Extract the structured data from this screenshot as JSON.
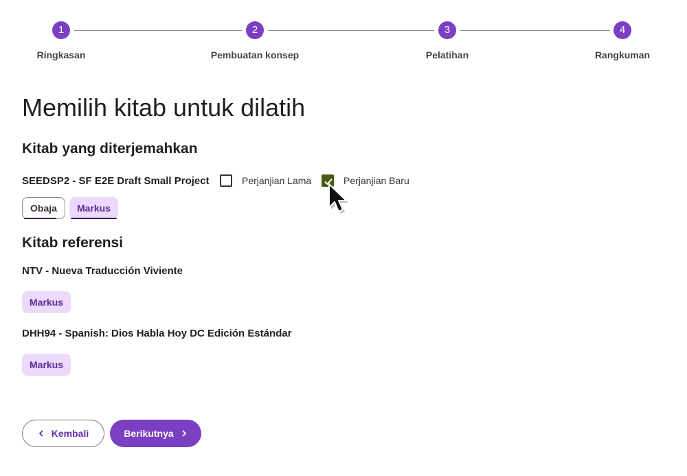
{
  "stepper": {
    "steps": [
      {
        "number": "1",
        "label": "Ringkasan"
      },
      {
        "number": "2",
        "label": "Pembuatan konsep"
      },
      {
        "number": "3",
        "label": "Pelatihan"
      },
      {
        "number": "4",
        "label": "Rangkuman"
      }
    ]
  },
  "page_title": "Memilih kitab untuk dilatih",
  "translated": {
    "section_title": "Kitab yang diterjemahkan",
    "project_name": "SEEDSP2 - SF E2E Draft Small Project",
    "old_testament_label": "Perjanjian Lama",
    "new_testament_label": "Perjanjian Baru",
    "books": [
      "Obaja",
      "Markus"
    ]
  },
  "reference": {
    "section_title": "Kitab referensi",
    "sources": [
      {
        "name": "NTV - Nueva Traducción Viviente",
        "books": [
          "Markus"
        ]
      },
      {
        "name": "DHH94 - Spanish: Dios Habla Hoy DC Edición Estándar",
        "books": [
          "Markus"
        ]
      }
    ]
  },
  "buttons": {
    "back_label": "Kembali",
    "next_label": "Berikutnya"
  },
  "colors": {
    "accent": "#7b3fc1",
    "chip_fill": "#ecd9fb",
    "checkbox_checked": "#4a5a12"
  },
  "icons": {
    "back": "chevron-left-icon",
    "next": "chevron-right-icon",
    "cursor": "mouse-pointer-icon"
  }
}
